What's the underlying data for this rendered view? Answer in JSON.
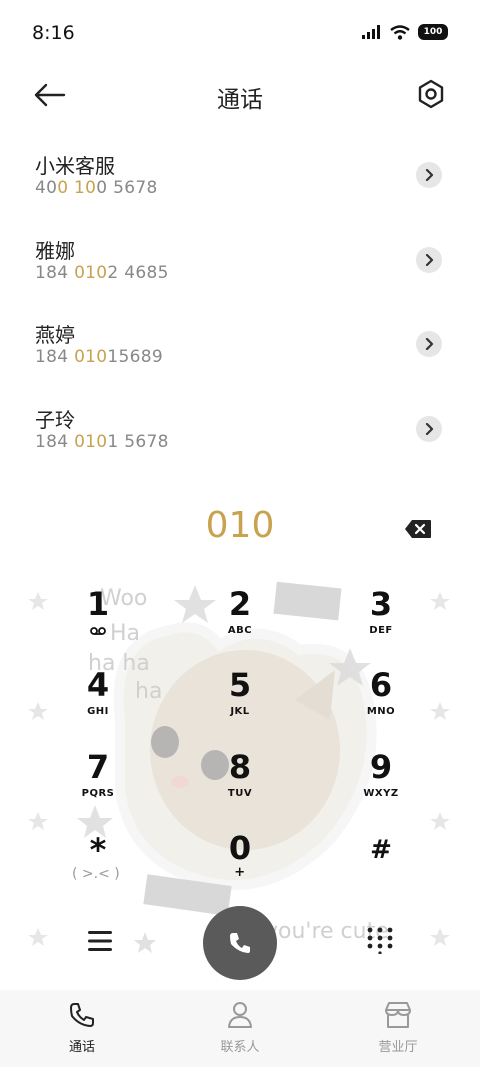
{
  "status": {
    "time": "8:16",
    "battery": "100"
  },
  "header": {
    "title": "通话"
  },
  "contacts": [
    {
      "name": "小米客服",
      "num_parts": [
        "40",
        "0 10",
        "0 5678"
      ]
    },
    {
      "name": "雅娜",
      "num_parts": [
        "184 ",
        "010",
        "2 4685"
      ]
    },
    {
      "name": "燕婷",
      "num_parts": [
        "184 ",
        "010",
        "15689"
      ]
    },
    {
      "name": "子玲",
      "num_parts": [
        "184 ",
        "010",
        "1 5678"
      ]
    }
  ],
  "dialer": {
    "input": "010",
    "keys": [
      {
        "digit": "1",
        "letters": ""
      },
      {
        "digit": "2",
        "letters": "ABC"
      },
      {
        "digit": "3",
        "letters": "DEF"
      },
      {
        "digit": "4",
        "letters": "GHI"
      },
      {
        "digit": "5",
        "letters": "JKL"
      },
      {
        "digit": "6",
        "letters": "MNO"
      },
      {
        "digit": "7",
        "letters": "PQRS"
      },
      {
        "digit": "8",
        "letters": "TUV"
      },
      {
        "digit": "9",
        "letters": "WXYZ"
      },
      {
        "digit": "*",
        "letters": ""
      },
      {
        "digit": "0",
        "letters": "+"
      },
      {
        "digit": "#",
        "letters": ""
      }
    ]
  },
  "background_text": {
    "t1": "Woo",
    "t2": "Ha",
    "t3": "ha ha",
    "t4": "ha",
    "t5": "you're cute",
    "t6": "( >.< )"
  },
  "tabs": [
    {
      "label": "通话",
      "icon": "phone-icon"
    },
    {
      "label": "联系人",
      "icon": "person-icon"
    },
    {
      "label": "营业厅",
      "icon": "store-icon"
    }
  ],
  "colors": {
    "accent": "#c8a24e",
    "call_button": "#5a5a5a"
  }
}
